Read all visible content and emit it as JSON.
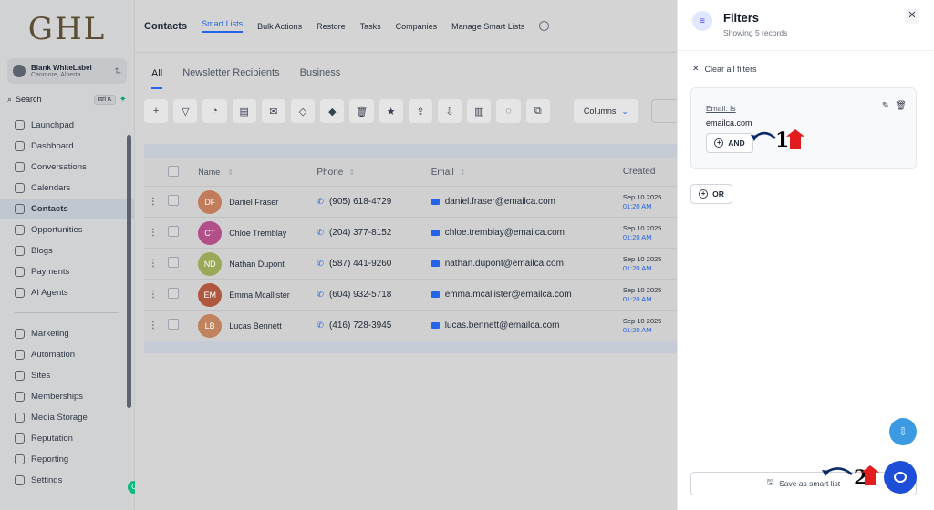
{
  "sidebar": {
    "logo": "GHL",
    "account_name": "Blank WhiteLabel",
    "account_location": "Canmore, Alberta",
    "search_label": "Search",
    "search_shortcut": "ctrl K",
    "items_top": [
      {
        "label": "Launchpad",
        "icon": "rocket-icon"
      },
      {
        "label": "Dashboard",
        "icon": "grid-icon"
      },
      {
        "label": "Conversations",
        "icon": "chat-icon"
      },
      {
        "label": "Calendars",
        "icon": "calendar-icon"
      },
      {
        "label": "Contacts",
        "icon": "contacts-icon",
        "active": true
      },
      {
        "label": "Opportunities",
        "icon": "target-icon"
      },
      {
        "label": "Blogs",
        "icon": "blog-icon"
      },
      {
        "label": "Payments",
        "icon": "card-icon"
      },
      {
        "label": "AI Agents",
        "icon": "sparkle-icon"
      }
    ],
    "items_bottom": [
      {
        "label": "Marketing",
        "icon": "send-icon"
      },
      {
        "label": "Automation",
        "icon": "automation-icon"
      },
      {
        "label": "Sites",
        "icon": "globe-icon"
      },
      {
        "label": "Memberships",
        "icon": "membership-icon"
      },
      {
        "label": "Media Storage",
        "icon": "image-icon"
      },
      {
        "label": "Reputation",
        "icon": "star-icon"
      },
      {
        "label": "Reporting",
        "icon": "chart-icon"
      },
      {
        "label": "Settings",
        "icon": "gear-icon"
      }
    ],
    "badge": "C"
  },
  "topbar": {
    "title": "Contacts",
    "tabs": [
      "Smart Lists",
      "Bulk Actions",
      "Restore",
      "Tasks",
      "Companies",
      "Manage Smart Lists"
    ]
  },
  "subtabs": [
    "All",
    "Newsletter Recipients",
    "Business"
  ],
  "toolbar": {
    "columns_label": "Columns"
  },
  "table": {
    "headers": {
      "name": "Name",
      "phone": "Phone",
      "email": "Email",
      "created": "Created"
    },
    "rows": [
      {
        "initials": "DF",
        "name": "Daniel Fraser",
        "phone": "(905) 618-4729",
        "email": "daniel.fraser@emailca.com",
        "date": "Sep 10 2025",
        "time": "01:20 AM",
        "color": "#c27c5a"
      },
      {
        "initials": "CT",
        "name": "Chloe Tremblay",
        "phone": "(204) 377-8152",
        "email": "chloe.tremblay@emailca.com",
        "date": "Sep 10 2025",
        "time": "01:20 AM",
        "color": "#b24f8a"
      },
      {
        "initials": "ND",
        "name": "Nathan Dupont",
        "phone": "(587) 441-9260",
        "email": "nathan.dupont@emailca.com",
        "date": "Sep 10 2025",
        "time": "01:20 AM",
        "color": "#9aa957"
      },
      {
        "initials": "EM",
        "name": "Emma Mcallister",
        "phone": "(604) 932-5718",
        "email": "emma.mcallister@emailca.com",
        "date": "Sep 10 2025",
        "time": "01:20 AM",
        "color": "#b0573f"
      },
      {
        "initials": "LB",
        "name": "Lucas Bennett",
        "phone": "(416) 728-3945",
        "email": "lucas.bennett@emailca.com",
        "date": "Sep 10 2025",
        "time": "01:20 AM",
        "color": "#c1835e"
      }
    ]
  },
  "panel": {
    "title": "Filters",
    "subtitle": "Showing 5 records",
    "clear_all": "Clear all filters",
    "filter_label": "Email: Is",
    "filter_value": "emailca.com",
    "and_label": "AND",
    "or_label": "OR",
    "save_label": "Save as smart list"
  },
  "annotations": {
    "one": "1",
    "two": "2"
  }
}
